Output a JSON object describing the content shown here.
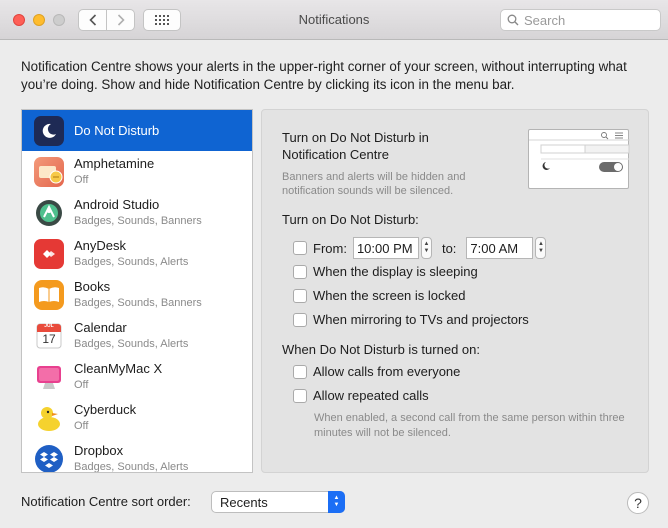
{
  "window": {
    "title": "Notifications"
  },
  "search": {
    "placeholder": "Search"
  },
  "intro": "Notification Centre shows your alerts in the upper-right corner of your screen, without interrupting what you’re doing. Show and hide Notification Centre by clicking its icon in the menu bar.",
  "apps": [
    {
      "name": "Do Not Disturb",
      "subtitle": "",
      "icon": "moon-icon"
    },
    {
      "name": "Amphetamine",
      "subtitle": "Off",
      "icon": "amphetamine-icon"
    },
    {
      "name": "Android Studio",
      "subtitle": "Badges, Sounds, Banners",
      "icon": "android-studio-icon"
    },
    {
      "name": "AnyDesk",
      "subtitle": "Badges, Sounds, Alerts",
      "icon": "anydesk-icon"
    },
    {
      "name": "Books",
      "subtitle": "Badges, Sounds, Banners",
      "icon": "books-icon"
    },
    {
      "name": "Calendar",
      "subtitle": "Badges, Sounds, Alerts",
      "icon": "calendar-icon"
    },
    {
      "name": "CleanMyMac X",
      "subtitle": "Off",
      "icon": "cleanmymac-icon"
    },
    {
      "name": "Cyberduck",
      "subtitle": "Off",
      "icon": "cyberduck-icon"
    },
    {
      "name": "Dropbox",
      "subtitle": "Badges, Sounds, Alerts",
      "icon": "dropbox-icon"
    }
  ],
  "calendar_icon": {
    "month": "JUL",
    "day": "17"
  },
  "dnd": {
    "heading": "Turn on Do Not Disturb in Notification Centre",
    "note": "Banners and alerts will be hidden and notification sounds will be silenced.",
    "schedule_heading": "Turn on Do Not Disturb:",
    "from_label": "From:",
    "from_time": "10:00 PM",
    "to_label": "to:",
    "to_time": "7:00 AM",
    "display_sleeping": "When the display is sleeping",
    "screen_locked": "When the screen is locked",
    "mirroring": "When mirroring to TVs and projectors",
    "when_on_heading": "When Do Not Disturb is turned on:",
    "allow_everyone": "Allow calls from everyone",
    "allow_repeated": "Allow repeated calls",
    "repeated_note": "When enabled, a second call from the same person within three minutes will not be silenced."
  },
  "sort": {
    "label": "Notification Centre sort order:",
    "value": "Recents"
  },
  "help": {
    "label": "?"
  },
  "colors": {
    "selection": "#0f64d2",
    "popup_accent": "#1b6ef5"
  }
}
